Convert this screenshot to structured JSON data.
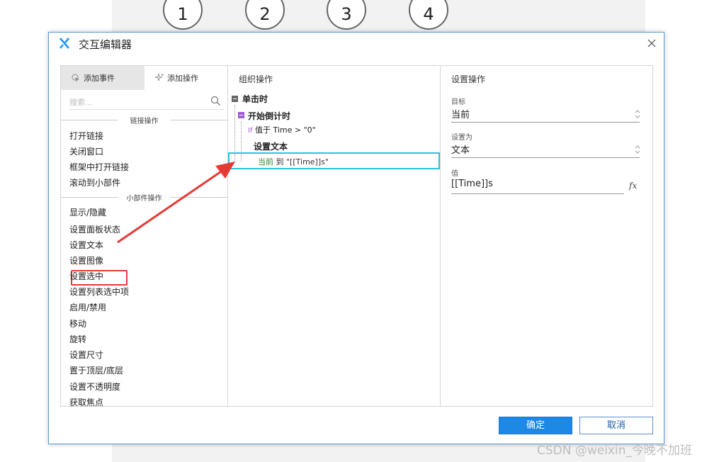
{
  "background": {
    "step_circles": [
      "1",
      "2",
      "3",
      "4"
    ]
  },
  "dialog": {
    "title": "交互编辑器",
    "left_panel": {
      "tabs": [
        "添加事件",
        "添加操作"
      ],
      "search_placeholder": "搜索...",
      "groups": [
        {
          "title": "链接操作",
          "items": [
            "打开链接",
            "关闭窗口",
            "框架中打开链接",
            "滚动到小部件"
          ]
        },
        {
          "title": "小部件操作",
          "items": [
            "显示/隐藏",
            "设置面板状态",
            "设置文本",
            "设置图像",
            "设置选中",
            "设置列表选中项",
            "启用/禁用",
            "移动",
            "旋转",
            "设置尺寸",
            "置于顶层/底层",
            "设置不透明度",
            "获取焦点"
          ]
        }
      ]
    },
    "middle_panel": {
      "title": "组织操作",
      "event": "单击时",
      "case": "开始倒计时",
      "condition_prefix": "If",
      "condition": "值于 Time > \"0\"",
      "action": "设置文本",
      "action_target": "当前",
      "action_detail": " 到 \"[[Time]]s\""
    },
    "right_panel": {
      "title": "设置操作",
      "target_label": "目标",
      "target_value": "当前",
      "set_as_label": "设置为",
      "set_as_value": "文本",
      "value_label": "值",
      "value_value": "[[Time]]s",
      "fx_label": "fx"
    },
    "buttons": {
      "ok": "确定",
      "cancel": "取消"
    }
  },
  "watermark": "CSDN @weixin_今晚不加班",
  "colors": {
    "accent": "#1e88e5",
    "highlight_red": "#e53935",
    "selection_cyan": "#26c6da",
    "case_purple": "#a05bd6",
    "target_green": "#2e8b2e"
  }
}
